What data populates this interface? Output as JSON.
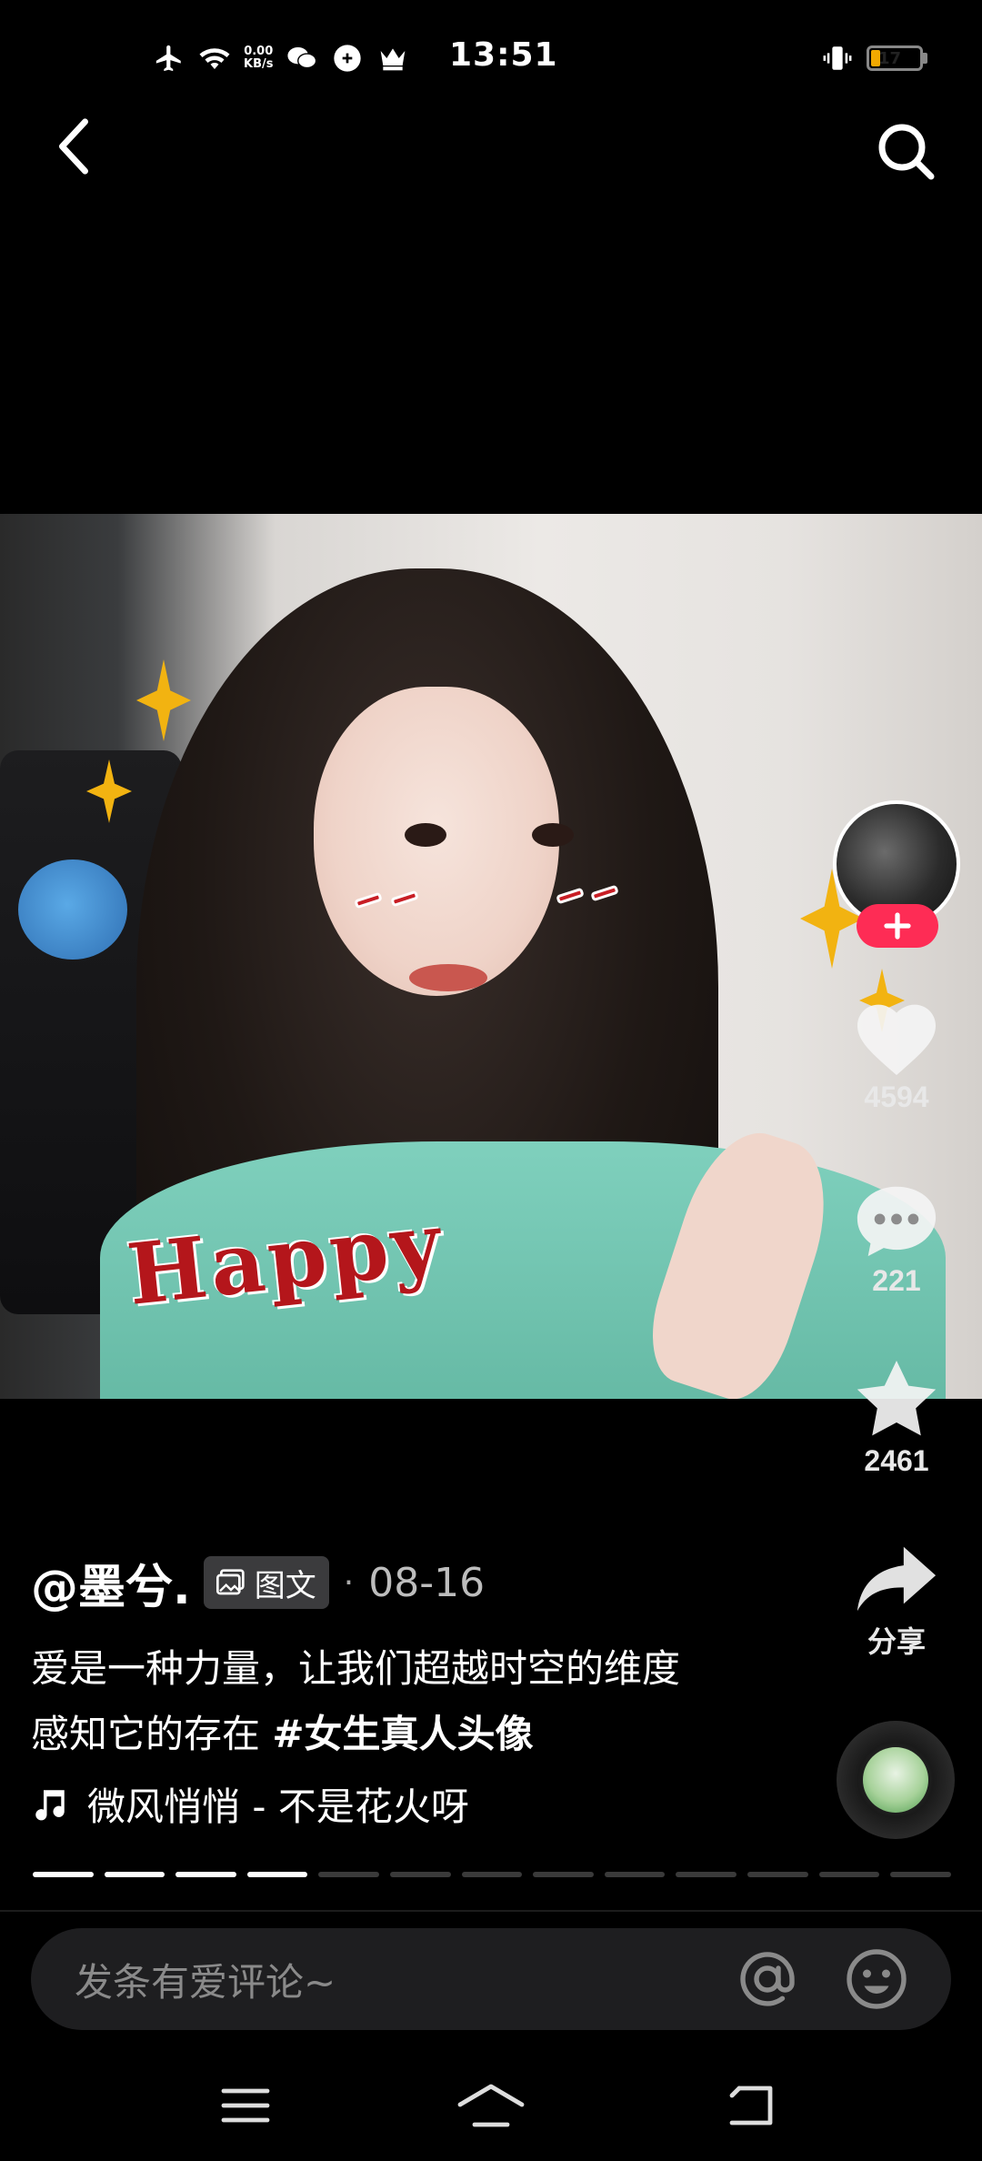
{
  "status_bar": {
    "net_speed_value": "0.00",
    "net_speed_unit": "KB/s",
    "time": "13:51",
    "battery_level": "17",
    "battery_fraction": 0.17,
    "battery_color": "#f2a900",
    "icons": [
      "airplane-icon",
      "wifi-icon",
      "wechat-icon",
      "soul-icon",
      "crown-icon",
      "vibrate-icon"
    ]
  },
  "top_nav": {
    "back_icon": "chevron-left-icon",
    "search_icon": "search-icon"
  },
  "post_image": {
    "overlay_text": "Happy"
  },
  "rail": {
    "follow_icon": "plus-icon",
    "follow_color": "#fe2c55",
    "likes": "4594",
    "comments": "221",
    "favorites": "2461",
    "share_label": "分享"
  },
  "caption": {
    "author": "@墨兮.",
    "type_tag": "图文",
    "separator": "·",
    "date": "08-16",
    "desc_line1": "爱是一种力量，让我们超越时空的维度",
    "desc_line2_text": "感知它的存在 ",
    "hashtag": "#女生真人头像",
    "music": "微风悄悄 - 不是花火呀"
  },
  "progress": {
    "total_segments": 13,
    "active_segments": 4
  },
  "comment_bar": {
    "placeholder": "发条有爱评论~",
    "mention_icon": "at-icon",
    "emoji_icon": "emoji-icon"
  },
  "nav_bar": {
    "icons": [
      "menu-icon",
      "home-icon",
      "back-arrow-icon"
    ]
  }
}
